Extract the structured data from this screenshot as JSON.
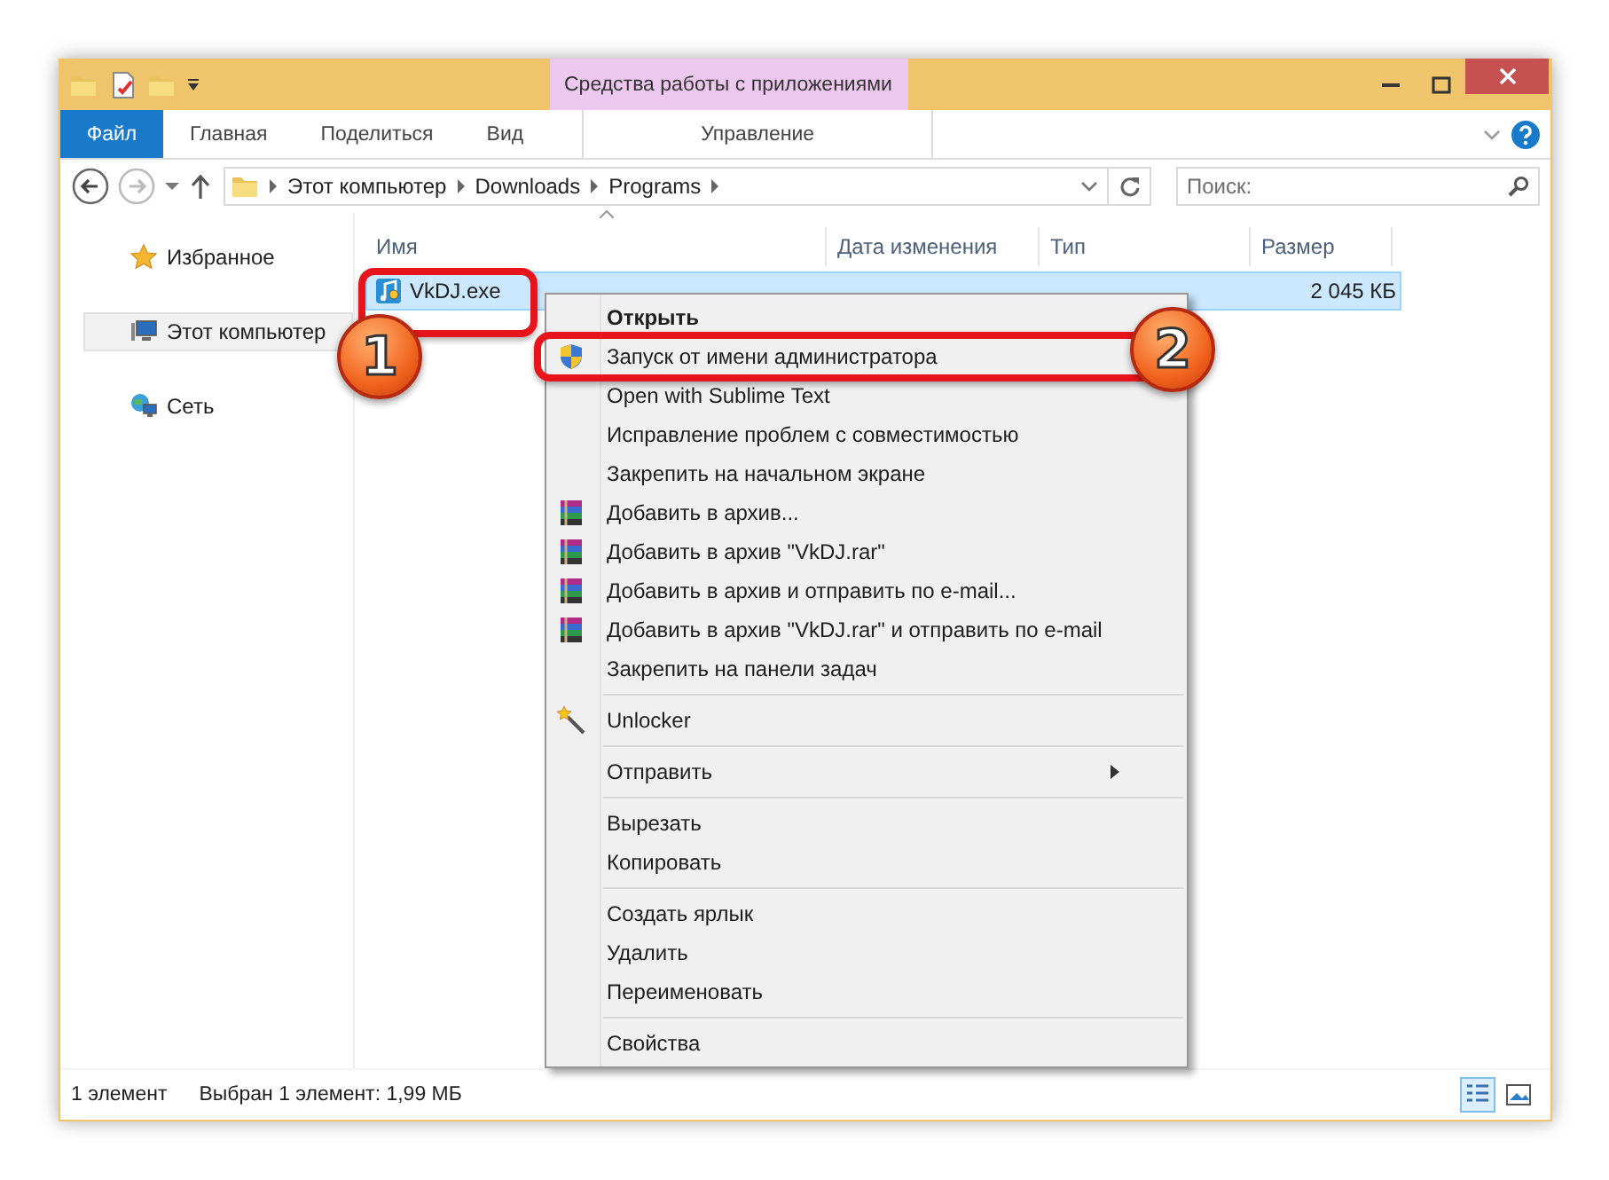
{
  "window": {
    "contextual_title": "Средства работы с приложениями"
  },
  "ribbon": {
    "tabs": [
      {
        "label": "Файл",
        "kind": "file"
      },
      {
        "label": "Главная",
        "kind": "plain"
      },
      {
        "label": "Поделиться",
        "kind": "plain"
      },
      {
        "label": "Вид",
        "kind": "plain"
      },
      {
        "label": "Управление",
        "kind": "contextual"
      }
    ]
  },
  "address": {
    "crumbs": [
      "Этот компьютер",
      "Downloads",
      "Programs"
    ],
    "search": {
      "placeholder": "Поиск:"
    }
  },
  "sidebar": {
    "items": [
      {
        "label": "Избранное",
        "kind": "favorites",
        "selected": false
      },
      {
        "label": "Этот компьютер",
        "kind": "computer",
        "selected": true
      },
      {
        "label": "Сеть",
        "kind": "network",
        "selected": false
      }
    ]
  },
  "table": {
    "columns": [
      {
        "label": "Имя",
        "sorted": true
      },
      {
        "label": "Дата изменения",
        "sorted": false
      },
      {
        "label": "Тип",
        "sorted": false
      },
      {
        "label": "Размер",
        "sorted": false
      }
    ],
    "rows": [
      {
        "name": "VkDJ.exe",
        "size": "2 045 КБ",
        "selected": true
      }
    ]
  },
  "context_menu": {
    "items": [
      {
        "label": "Открыть",
        "kind": "default",
        "separator_after": false
      },
      {
        "label": "Запуск от имени администратора",
        "kind": "shield",
        "separator_after": false
      },
      {
        "label": "Open with Sublime Text",
        "kind": "plain",
        "separator_after": false
      },
      {
        "label": "Исправление проблем с совместимостью",
        "kind": "plain",
        "separator_after": false
      },
      {
        "label": "Закрепить на начальном экране",
        "kind": "plain",
        "separator_after": false
      },
      {
        "label": "Добавить в архив...",
        "kind": "archive",
        "separator_after": false
      },
      {
        "label": "Добавить в архив \"VkDJ.rar\"",
        "kind": "archive",
        "separator_after": false
      },
      {
        "label": "Добавить в архив и отправить по e-mail...",
        "kind": "archive",
        "separator_after": false
      },
      {
        "label": "Добавить в архив \"VkDJ.rar\" и отправить по e-mail",
        "kind": "archive",
        "separator_after": false
      },
      {
        "label": "Закрепить на панели задач",
        "kind": "plain",
        "separator_after": true
      },
      {
        "label": "Unlocker",
        "kind": "wand",
        "separator_after": true
      },
      {
        "label": "Отправить",
        "kind": "submenu",
        "separator_after": true
      },
      {
        "label": "Вырезать",
        "kind": "plain",
        "separator_after": false
      },
      {
        "label": "Копировать",
        "kind": "plain",
        "separator_after": true
      },
      {
        "label": "Создать ярлык",
        "kind": "plain",
        "separator_after": false
      },
      {
        "label": "Удалить",
        "kind": "plain",
        "separator_after": false
      },
      {
        "label": "Переименовать",
        "kind": "plain",
        "separator_after": true
      },
      {
        "label": "Свойства",
        "kind": "plain",
        "separator_after": false
      }
    ]
  },
  "annotations": [
    {
      "number": "1",
      "kind": "file"
    },
    {
      "number": "2",
      "kind": "menu"
    }
  ],
  "status_bar": {
    "texts": [
      "1 элемент",
      "Выбран 1 элемент: 1,99 МБ"
    ],
    "views": [
      {
        "kind": "details",
        "selected": true
      },
      {
        "kind": "tiles",
        "selected": false
      }
    ]
  }
}
